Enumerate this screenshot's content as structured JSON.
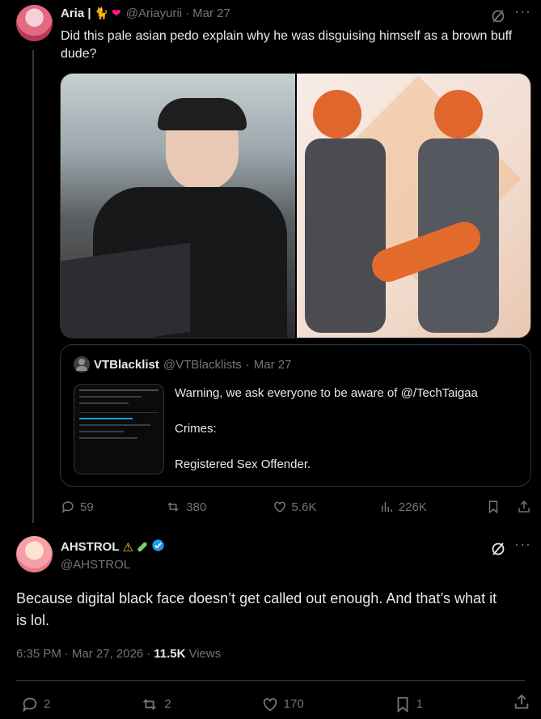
{
  "parent_tweet": {
    "display_name": "Aria |",
    "handle": "@Ariayurii",
    "date": "Mar 27",
    "text": "Did this pale asian pedo explain why he was disguising himself as a brown buff dude?",
    "quote": {
      "display_name": "VTBlacklist",
      "handle": "@VTBlacklists",
      "date": "Mar 27",
      "line1": "Warning, we ask everyone to be aware of @/TechTaigaa",
      "line2": "Crimes:",
      "line3": "Registered Sex Offender."
    },
    "stats": {
      "replies": "59",
      "reposts": "380",
      "likes": "5.6K",
      "views": "226K"
    }
  },
  "main_tweet": {
    "display_name": "AHSTROL",
    "handle": "@AHSTROL",
    "text": "Because digital black face doesn’t get called out enough. And that’s what it is lol.",
    "time": "6:35 PM",
    "date": "Mar 27, 2026",
    "views_count": "11.5K",
    "views_label": "Views",
    "stats": {
      "replies": "2",
      "reposts": "2",
      "likes": "170",
      "bookmarks": "1"
    }
  },
  "icons": {
    "accent": "#1d9bf0",
    "muted": "#71767b"
  }
}
